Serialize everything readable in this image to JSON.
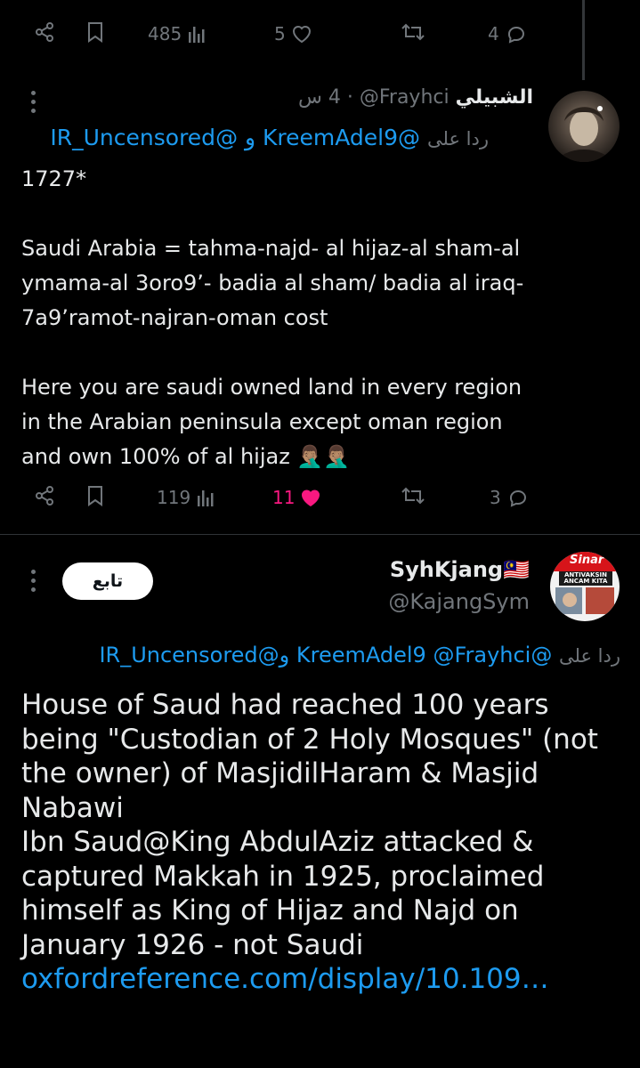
{
  "top_actions": {
    "views": "485",
    "likes": "5",
    "replies": "4"
  },
  "post1": {
    "display_name": "الشبيلي",
    "handle": "@Frayhci",
    "time": "4 س",
    "separator": "·",
    "reply_prefix": "ردا على",
    "reply_mentions": "@KreemAdel9 و @IR_Uncensored",
    "body": "1727*\n\nSaudi Arabia = tahma-najd- al hijaz-al sham-al ymama-al 3oro9’- badia al sham/ badia al iraq-7a9’ramot-najran-oman cost\n\nHere you are saudi owned land in every region in the Arabian peninsula except oman region and own 100% of al hijaz 🤦🏽‍♂️🤦🏽‍♂️",
    "views": "119",
    "likes": "11",
    "replies": "3",
    "like_color": "#f91880"
  },
  "post2": {
    "display_name": "SyhKjang🇲🇾",
    "handle": "@KajangSym",
    "follow_label": "تابع",
    "reply_prefix": "ردا على",
    "reply_mentions": "@KreemAdel9 @Frayhci و@IR_Uncensored",
    "body": "House of Saud had reached 100 years being \"Custodian of 2 Holy Mosques\" (not the owner) of MasjidilHaram & Masjid Nabawi\nIbn Saud@King AbdulAziz attacked & captured Makkah in 1925, proclaimed himself as King of Hijaz and Najd on January 1926 - not Saudi",
    "link": "oxfordreference.com/display/10.109…",
    "avatar_text_top": "Sinar",
    "avatar_text_mid": "ANTIVAKSIN ANCAM KITA"
  },
  "colors": {
    "background": "#000000",
    "text": "#e7e9ea",
    "muted": "#71767b",
    "link": "#1d9bf0",
    "like": "#f91880"
  }
}
